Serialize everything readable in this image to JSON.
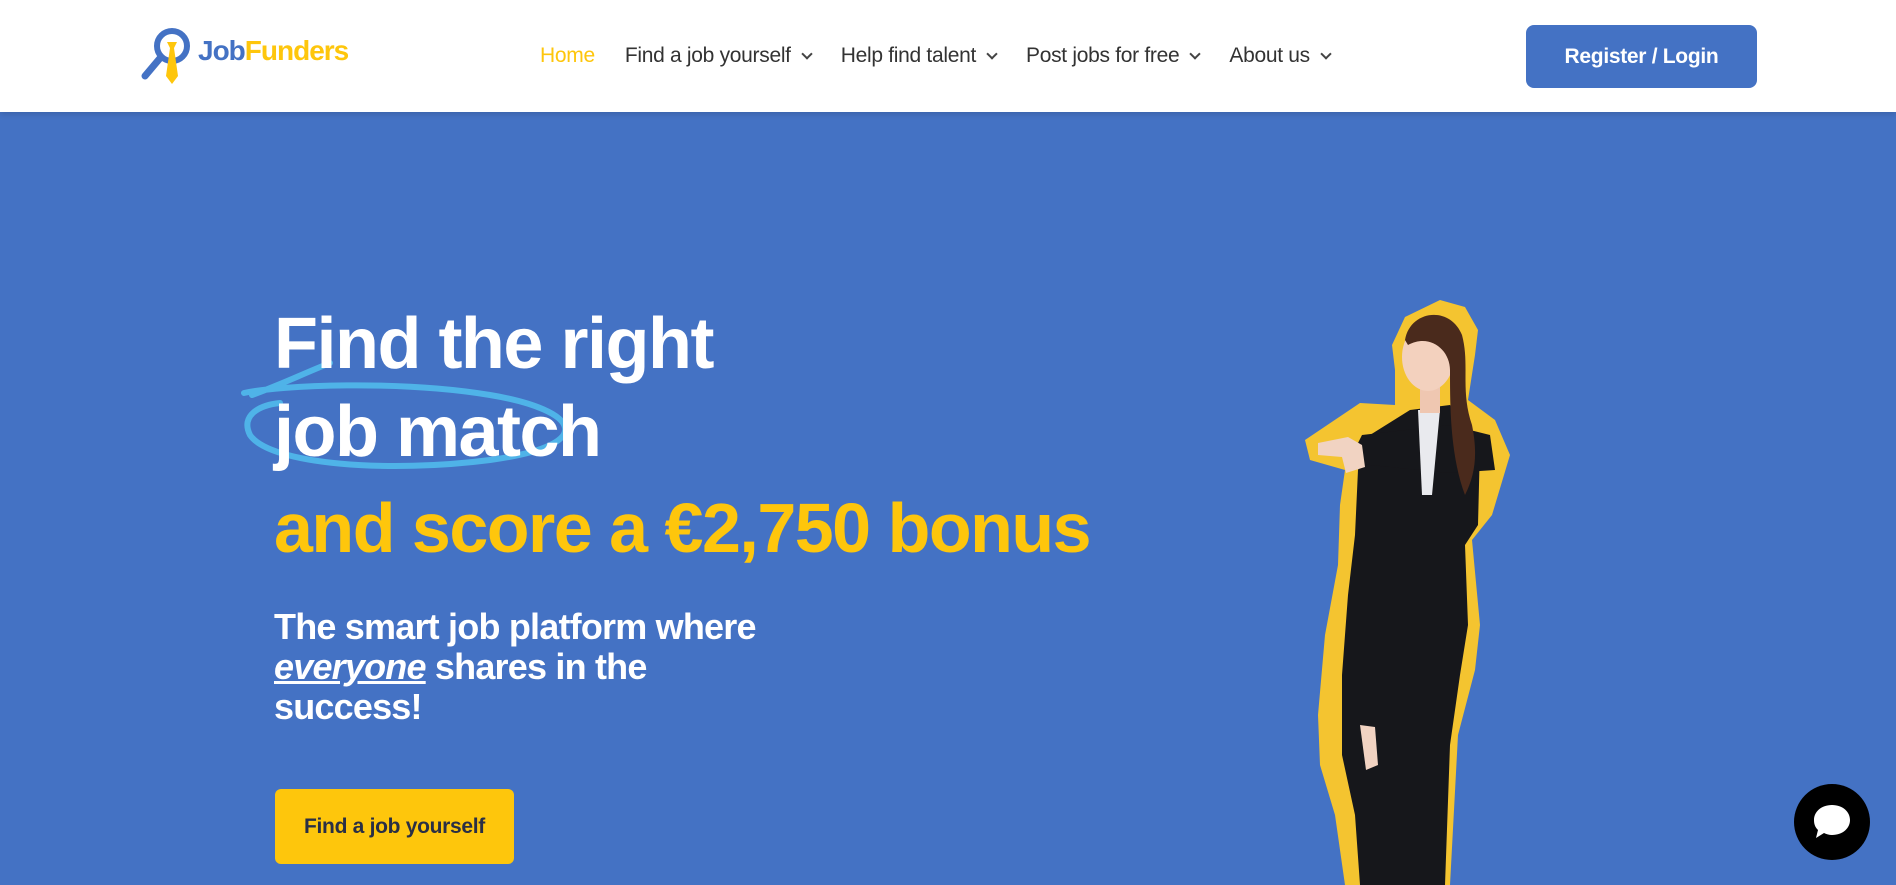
{
  "brand": {
    "name_part1": "Job",
    "name_part2": "Funders",
    "primary_color": "#4472c4",
    "accent_color": "#fec60c"
  },
  "nav": {
    "items": [
      {
        "label": "Home",
        "active": true,
        "dropdown": false
      },
      {
        "label": "Find a job yourself",
        "active": false,
        "dropdown": true
      },
      {
        "label": "Help find talent",
        "active": false,
        "dropdown": true
      },
      {
        "label": "Post jobs for free",
        "active": false,
        "dropdown": true
      },
      {
        "label": "About us",
        "active": false,
        "dropdown": true
      }
    ],
    "login_label": "Register / Login"
  },
  "hero": {
    "title_line1": "Find the right",
    "title_line2": "job match",
    "bonus_line": "and score a €2,750 bonus",
    "subtitle_pre": "The smart job platform where",
    "subtitle_emphasis": "everyone",
    "subtitle_post": "shares in the success!",
    "cta_label": "Find a job yourself"
  },
  "icons": {
    "logo": "magnifier-tie-icon",
    "chat": "chat-bubble-icon",
    "nav_dropdown": "chevron-down-icon"
  }
}
